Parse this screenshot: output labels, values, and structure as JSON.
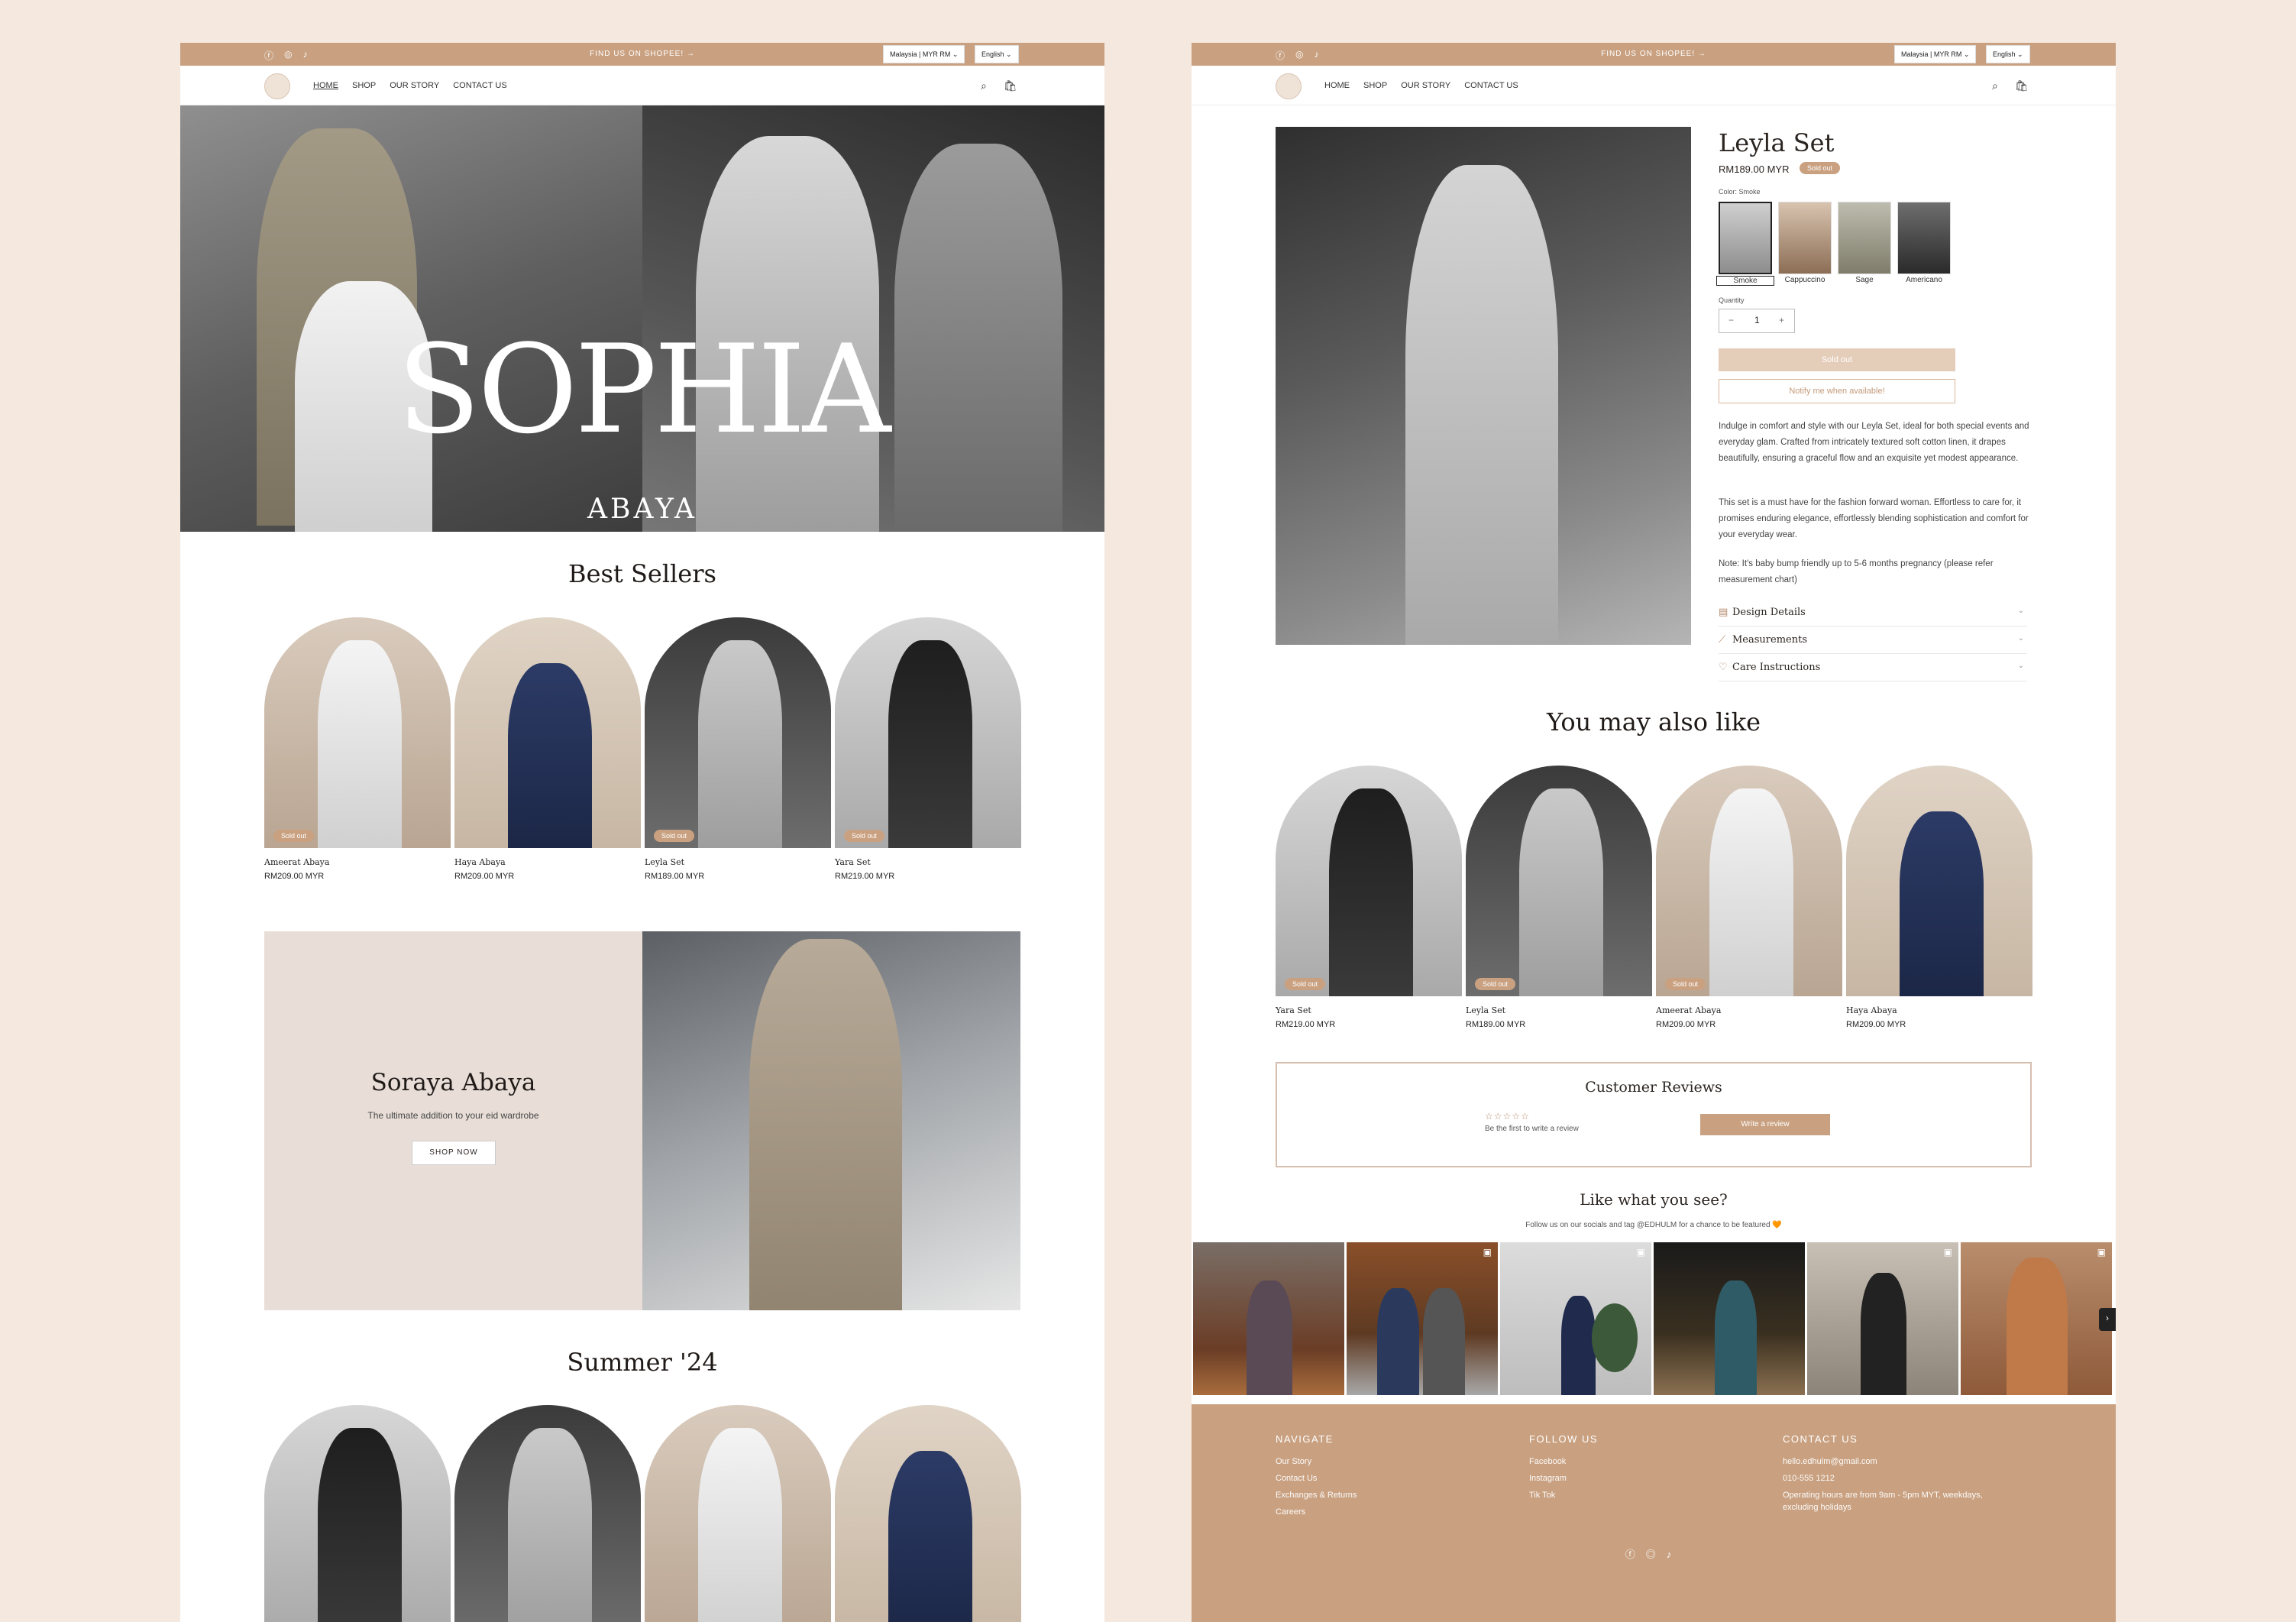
{
  "announcement": {
    "message": "FIND US ON SHOPEE! →",
    "region": "Malaysia | MYR RM",
    "language": "English"
  },
  "nav": {
    "links": [
      "HOME",
      "SHOP",
      "OUR STORY",
      "CONTACT US"
    ]
  },
  "hero": {
    "title": "SOPHIA",
    "subtitle": "ABAYA"
  },
  "best_sellers": {
    "title": "Best Sellers",
    "products": [
      {
        "name": "Ameerat Abaya",
        "price": "RM209.00 MYR",
        "badge": "Sold out"
      },
      {
        "name": "Haya Abaya",
        "price": "RM209.00 MYR",
        "badge": ""
      },
      {
        "name": "Leyla Set",
        "price": "RM189.00 MYR",
        "badge": "Sold out"
      },
      {
        "name": "Yara Set",
        "price": "RM219.00 MYR",
        "badge": "Sold out"
      }
    ]
  },
  "promo": {
    "title": "Soraya Abaya",
    "subtitle": "The ultimate addition to your eid wardrobe",
    "cta": "SHOP NOW"
  },
  "summer": {
    "title": "Summer '24"
  },
  "product": {
    "title": "Leyla Set",
    "price": "RM189.00 MYR",
    "badge": "Sold out",
    "color_label": "Color: Smoke",
    "swatches": [
      "Smoke",
      "Cappuccino",
      "Sage",
      "Americano"
    ],
    "quantity_label": "Quantity",
    "quantity": "1",
    "sold_out_btn": "Sold out",
    "notify_btn": "Notify me when available!",
    "desc1": "Indulge in comfort and style with our Leyla Set, ideal for both special events and everyday glam. Crafted from intricately textured soft cotton linen, it drapes beautifully, ensuring a graceful flow and an exquisite yet modest appearance.",
    "desc2": "This set is a must have for the fashion forward woman. Effortless to care for, it promises enduring elegance, effortlessly blending sophistication and comfort for your everyday wear.",
    "desc3": "Note: It's baby bump friendly up to 5-6 months pregnancy (please refer measurement chart)",
    "accordions": [
      "Design Details",
      "Measurements",
      "Care Instructions"
    ]
  },
  "also_like": {
    "title": "You may also like",
    "products": [
      {
        "name": "Yara Set",
        "price": "RM219.00 MYR",
        "badge": "Sold out"
      },
      {
        "name": "Leyla Set",
        "price": "RM189.00 MYR",
        "badge": "Sold out"
      },
      {
        "name": "Ameerat Abaya",
        "price": "RM209.00 MYR",
        "badge": "Sold out"
      },
      {
        "name": "Haya Abaya",
        "price": "RM209.00 MYR",
        "badge": ""
      }
    ]
  },
  "reviews": {
    "title": "Customer Reviews",
    "stars": "☆☆☆☆☆",
    "empty": "Be the first to write a review",
    "button": "Write a review"
  },
  "social": {
    "title": "Like what you see?",
    "subtitle": "Follow us on our socials and tag @EDHULM for a chance to be featured 🧡"
  },
  "footer": {
    "navigate": {
      "title": "NAVIGATE",
      "links": [
        "Our Story",
        "Contact Us",
        "Exchanges & Returns",
        "Careers"
      ]
    },
    "follow": {
      "title": "FOLLOW US",
      "links": [
        "Facebook",
        "Instagram",
        "Tik Tok"
      ]
    },
    "contact": {
      "title": "CONTACT US",
      "email": "hello.edhulm@gmail.com",
      "phone": "010-555 1212",
      "hours1": "Operating hours are from 9am - 5pm MYT, weekdays,",
      "hours2": "excluding holidays"
    }
  },
  "colors": {
    "accent": "#c9a181",
    "background": "#f5e9df"
  },
  "icons": [
    "facebook-icon",
    "instagram-icon",
    "tiktok-icon",
    "search-icon",
    "cart-icon",
    "chevron-down-icon",
    "arrow-right-icon",
    "reel-icon"
  ]
}
